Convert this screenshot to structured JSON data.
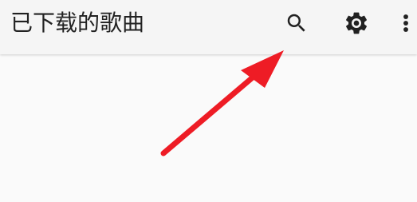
{
  "app_bar": {
    "title": "已下载的歌曲",
    "actions": [
      {
        "icon": "search-icon"
      },
      {
        "icon": "gear-icon"
      },
      {
        "icon": "more-vert-icon"
      }
    ]
  },
  "colors": {
    "app_bar_background": "#f5f5f5",
    "content_background": "#fafafa",
    "text_primary": "#212121",
    "annotation_arrow": "#ee1c25"
  }
}
